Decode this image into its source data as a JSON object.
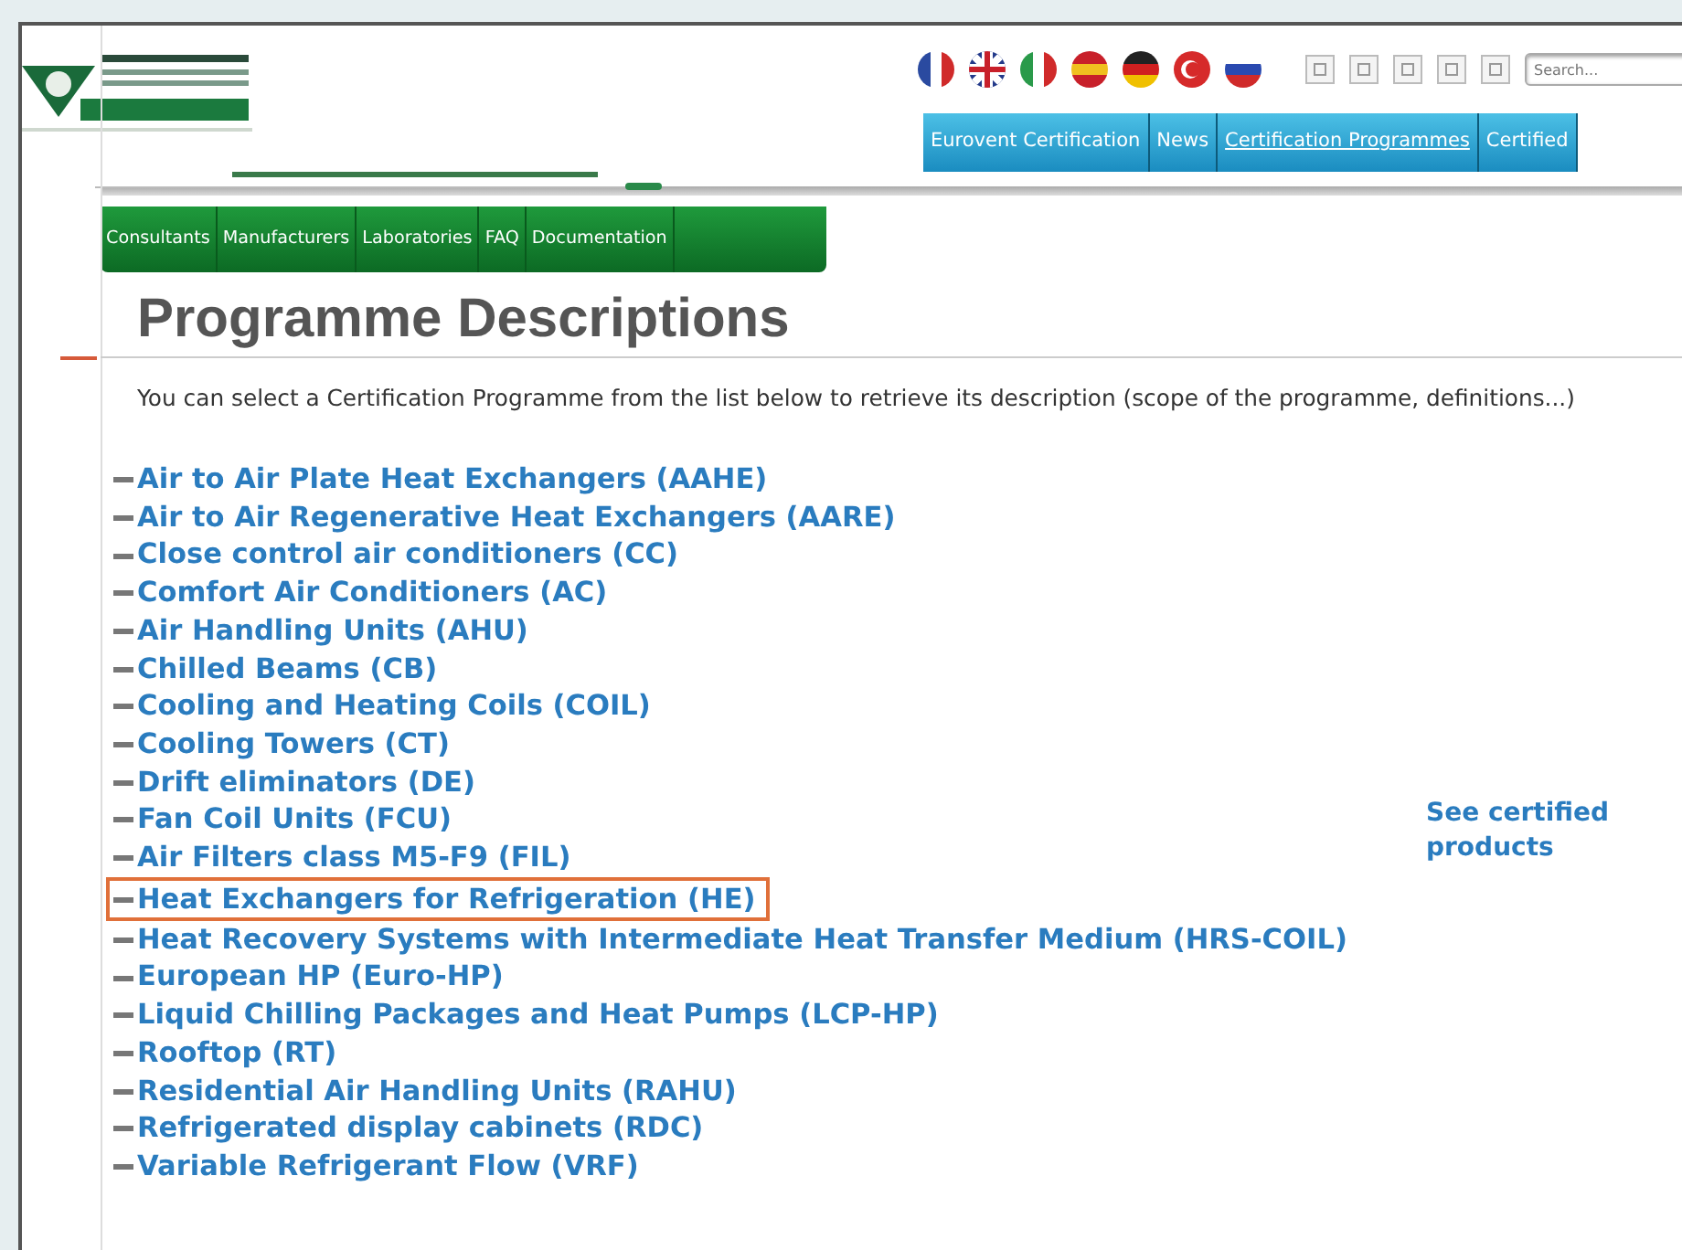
{
  "search": {
    "placeholder": "Search..."
  },
  "top_tabs": [
    {
      "label": "Eurovent Certification",
      "selected": false
    },
    {
      "label": "News",
      "selected": false
    },
    {
      "label": "Certification Programmes",
      "selected": true
    },
    {
      "label": "Certified",
      "selected": false
    }
  ],
  "sub_tabs": [
    "Consultants",
    "Manufacturers",
    "Laboratories",
    "FAQ",
    "Documentation"
  ],
  "heading": "Programme Descriptions",
  "intro": "You can select a Certification Programme from the list below to retrieve its description (scope of the programme, definitions...)",
  "programmes": [
    {
      "label": "Air to Air Plate Heat Exchangers (AAHE)",
      "highlighted": false
    },
    {
      "label": "Air to Air Regenerative Heat Exchangers (AARE)",
      "highlighted": false
    },
    {
      "label": "Close control air conditioners (CC)",
      "highlighted": false
    },
    {
      "label": "Comfort Air Conditioners (AC)",
      "highlighted": false
    },
    {
      "label": "Air Handling Units (AHU)",
      "highlighted": false
    },
    {
      "label": "Chilled Beams (CB)",
      "highlighted": false
    },
    {
      "label": "Cooling and Heating Coils (COIL)",
      "highlighted": false
    },
    {
      "label": "Cooling Towers (CT)",
      "highlighted": false
    },
    {
      "label": "Drift eliminators (DE)",
      "highlighted": false
    },
    {
      "label": "Fan Coil Units (FCU)",
      "highlighted": false
    },
    {
      "label": "Air Filters class M5-F9 (FIL)",
      "highlighted": false
    },
    {
      "label": "Heat Exchangers for Refrigeration (HE)",
      "highlighted": true
    },
    {
      "label": "Heat Recovery Systems with Intermediate Heat Transfer Medium (HRS-COIL)",
      "highlighted": false
    },
    {
      "label": "European HP (Euro-HP)",
      "highlighted": false
    },
    {
      "label": "Liquid Chilling Packages and Heat Pumps (LCP-HP)",
      "highlighted": false
    },
    {
      "label": "Rooftop (RT)",
      "highlighted": false
    },
    {
      "label": "Residential Air Handling Units (RAHU)",
      "highlighted": false
    },
    {
      "label": "Refrigerated display cabinets (RDC)",
      "highlighted": false
    },
    {
      "label": "Variable Refrigerant Flow (VRF)",
      "highlighted": false
    }
  ],
  "side_link": "See certified products"
}
